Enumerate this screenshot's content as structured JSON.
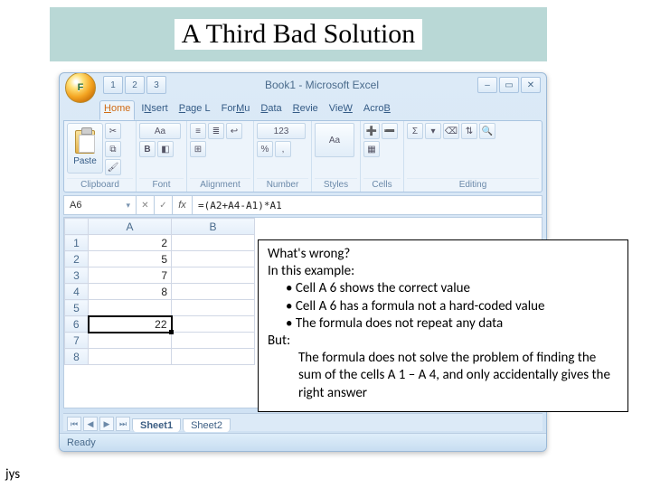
{
  "slide": {
    "title": "A Third Bad Solution",
    "footer": "jys"
  },
  "excel": {
    "orb_letter": "F",
    "qat": [
      "1",
      "2",
      "3"
    ],
    "window_title": "Book1 - Microsoft Excel",
    "win_min": "–",
    "win_max": "▭",
    "win_close": "✕",
    "tabs": [
      "Home",
      "Insert",
      "Page L",
      "Formu",
      "Data",
      "Revie",
      "View",
      "Acrob"
    ],
    "tab_underlines": [
      "H",
      "N",
      "P",
      "M",
      "D",
      "R",
      "W",
      "B"
    ],
    "ribbon": {
      "paste_label": "Paste",
      "groups": [
        "Clipboard",
        "Font",
        "Alignment",
        "Number",
        "Styles",
        "Cells",
        "Editing"
      ]
    },
    "formula_bar": {
      "namebox": "A6",
      "btn_cancel": "✕",
      "btn_enter": "✓",
      "fx": "fx",
      "formula": "=(A2+A4-A1)*A1"
    },
    "grid": {
      "col_headers": [
        "A",
        "B"
      ],
      "rows": [
        {
          "h": "1",
          "cells": [
            "2",
            ""
          ]
        },
        {
          "h": "2",
          "cells": [
            "5",
            ""
          ]
        },
        {
          "h": "3",
          "cells": [
            "7",
            ""
          ]
        },
        {
          "h": "4",
          "cells": [
            "8",
            ""
          ]
        },
        {
          "h": "5",
          "cells": [
            "",
            ""
          ]
        },
        {
          "h": "6",
          "cells": [
            "22",
            ""
          ]
        },
        {
          "h": "7",
          "cells": [
            "",
            ""
          ]
        },
        {
          "h": "8",
          "cells": [
            "",
            ""
          ]
        }
      ],
      "active_cell": {
        "row": 6,
        "col": 1
      }
    },
    "sheets": [
      "Sheet1",
      "Sheet2"
    ],
    "status": "Ready"
  },
  "callout": {
    "heading": "What's wrong?",
    "intro": "In this example:",
    "bullets": [
      "Cell A 6 shows the correct value",
      "Cell A 6 has a formula not a hard-coded value",
      "The formula does not repeat any data"
    ],
    "but_label": "But:",
    "but_text": "The formula does not solve the problem of finding the sum of the cells A 1 – A 4, and only accidentally gives the right answer"
  }
}
